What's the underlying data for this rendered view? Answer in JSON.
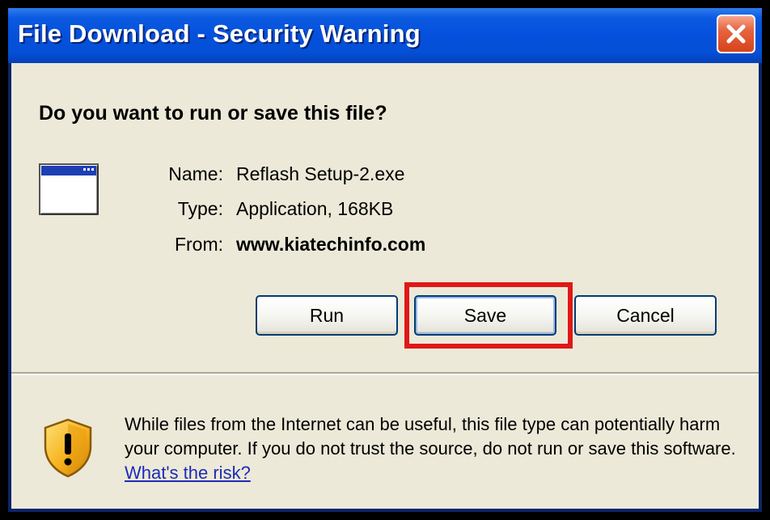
{
  "window": {
    "title": "File Download - Security Warning",
    "close_icon": "close-icon"
  },
  "dialog": {
    "question": "Do you want to run or save this file?",
    "file_icon": "application-window-icon",
    "name_label": "Name:",
    "name_value": "Reflash Setup-2.exe",
    "type_label": "Type:",
    "type_value": "Application, 168KB",
    "from_label": "From:",
    "from_value": "www.kiatechinfo.com"
  },
  "buttons": {
    "run": "Run",
    "save": "Save",
    "cancel": "Cancel"
  },
  "warning": {
    "icon": "shield-warning-icon",
    "text": "While files from the Internet can be useful, this file type can potentially harm your computer. If you do not trust the source, do not run or save this software. ",
    "link": "What's the risk?"
  },
  "colors": {
    "titlebar": "#0550dc",
    "client_bg": "#ece9d8",
    "highlight": "#e01818",
    "link": "#1c2bb8",
    "close_button": "#d6431c"
  }
}
